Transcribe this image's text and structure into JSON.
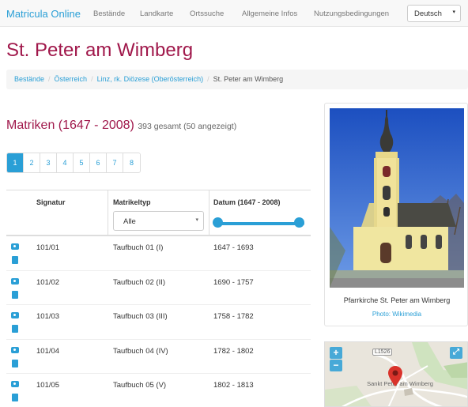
{
  "navbar": {
    "brand": "Matricula Online",
    "links": [
      "Bestände",
      "Landkarte",
      "Ortssuche",
      "Allgemeine Infos",
      "Nutzungsbedingungen"
    ],
    "language": "Deutsch"
  },
  "page_title": "St. Peter am Wimberg",
  "breadcrumb": {
    "items": [
      "Bestände",
      "Österreich",
      "Linz, rk. Diözese (Oberösterreich)"
    ],
    "current": "St. Peter am Wimberg"
  },
  "matriken": {
    "title": "Matriken (1647 - 2008)",
    "count": "393 gesamt (50 angezeigt)"
  },
  "pagination": [
    "1",
    "2",
    "3",
    "4",
    "5",
    "6",
    "7",
    "8"
  ],
  "pagination_active": "1",
  "table": {
    "headers": {
      "signatur": "Signatur",
      "matrikeltyp": "Matrikeltyp",
      "datum": "Datum (1647 - 2008)"
    },
    "type_filter": "Alle",
    "date_range_slider": {
      "min": 1647,
      "max": 2008,
      "selected_min": 1647,
      "selected_max": 2008
    },
    "rows": [
      {
        "signatur": "101/01",
        "typ": "Taufbuch 01 (I)",
        "datum": "1647 - 1693"
      },
      {
        "signatur": "101/02",
        "typ": "Taufbuch 02 (II)",
        "datum": "1690 - 1757"
      },
      {
        "signatur": "101/03",
        "typ": "Taufbuch 03 (III)",
        "datum": "1758 - 1782"
      },
      {
        "signatur": "101/04",
        "typ": "Taufbuch 04 (IV)",
        "datum": "1782 - 1802"
      },
      {
        "signatur": "101/05",
        "typ": "Taufbuch 05 (V)",
        "datum": "1802 - 1813"
      }
    ]
  },
  "image": {
    "caption": "Pfarrkirche St. Peter am Wimberg",
    "credit": "Photo: Wikimedia"
  },
  "map": {
    "zoom_in": "+",
    "zoom_out": "−",
    "fullscreen": "⤢",
    "road_label": "L1526",
    "place_label": "Sankt Peter am Wimberg"
  },
  "colors": {
    "brand": "#2a9fd6",
    "title": "#a0184b"
  }
}
